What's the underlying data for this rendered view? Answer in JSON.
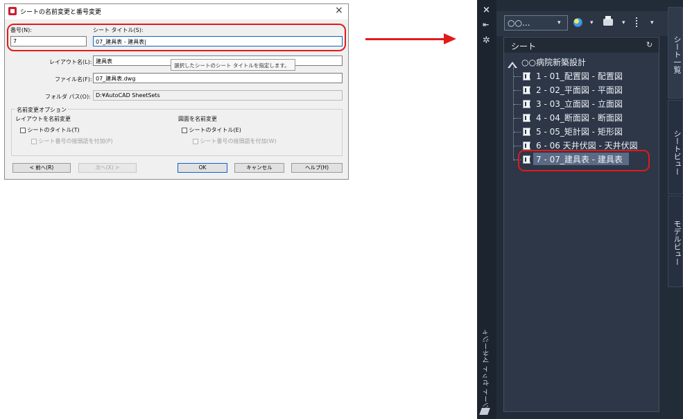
{
  "dialog": {
    "title": "シートの名前変更と番号変更",
    "close_glyph": "×",
    "number_label": "番号(N):",
    "number_value": "7",
    "sheet_title_label": "シート タイトル(S):",
    "sheet_title_value": "07_建具表 - 建具表|",
    "layout_name_label": "レイアウト名(L):",
    "layout_name_value": "建具表",
    "tooltip": "選択したシートのシート タイトルを指定します。",
    "file_name_label": "ファイル名(F):",
    "file_name_value": "07_建具表.dwg",
    "folder_path_label": "フォルダ パス(O):",
    "folder_path_value": "D:¥AutoCAD SheetSets",
    "options_group_label": "名前変更オプション",
    "layout_rename_heading": "レイアウトを名前変更",
    "layout_sheet_title_option": "シートのタイトル(T)",
    "layout_prefix_option": "シート番号の接頭語を付加(P)",
    "drawing_rename_heading": "図面を名前変更",
    "drawing_sheet_title_option": "シートのタイトル(E)",
    "drawing_prefix_option": "シート番号の接頭語を付加(W)",
    "btn_prev": "< 前へ(R)",
    "btn_next": "次へ(X) >",
    "btn_ok": "OK",
    "btn_cancel": "キャンセル",
    "btn_help": "ヘルプ(H)"
  },
  "palette": {
    "close_glyph": "×",
    "pin_glyph": "⇤",
    "settings_glyph": "✲",
    "vertical_title": "シート セット マネージャ",
    "dropdown_value": "○○...",
    "caret": "▾",
    "panel_title": "シート",
    "refresh_glyph": "↻",
    "sheet_set_name": "○○病院新築設計",
    "sheets": [
      "1 - 01_配置図 - 配置図",
      "2 - 02_平面図 - 平面図",
      "3 - 03_立面図 - 立面図",
      "4 - 04_断面図 - 断面図",
      "5 - 05_矩計図 - 矩形図",
      "6 - 06 天井伏図 - 天井伏図",
      "7 - 07_建具表 - 建具表"
    ],
    "tabs": [
      "シート一覧",
      "シートビュー",
      "モデルビュー"
    ]
  },
  "colors": {
    "highlight": "#e21a1a",
    "palette_bg": "#222b38",
    "selection": "#5b6a85"
  }
}
